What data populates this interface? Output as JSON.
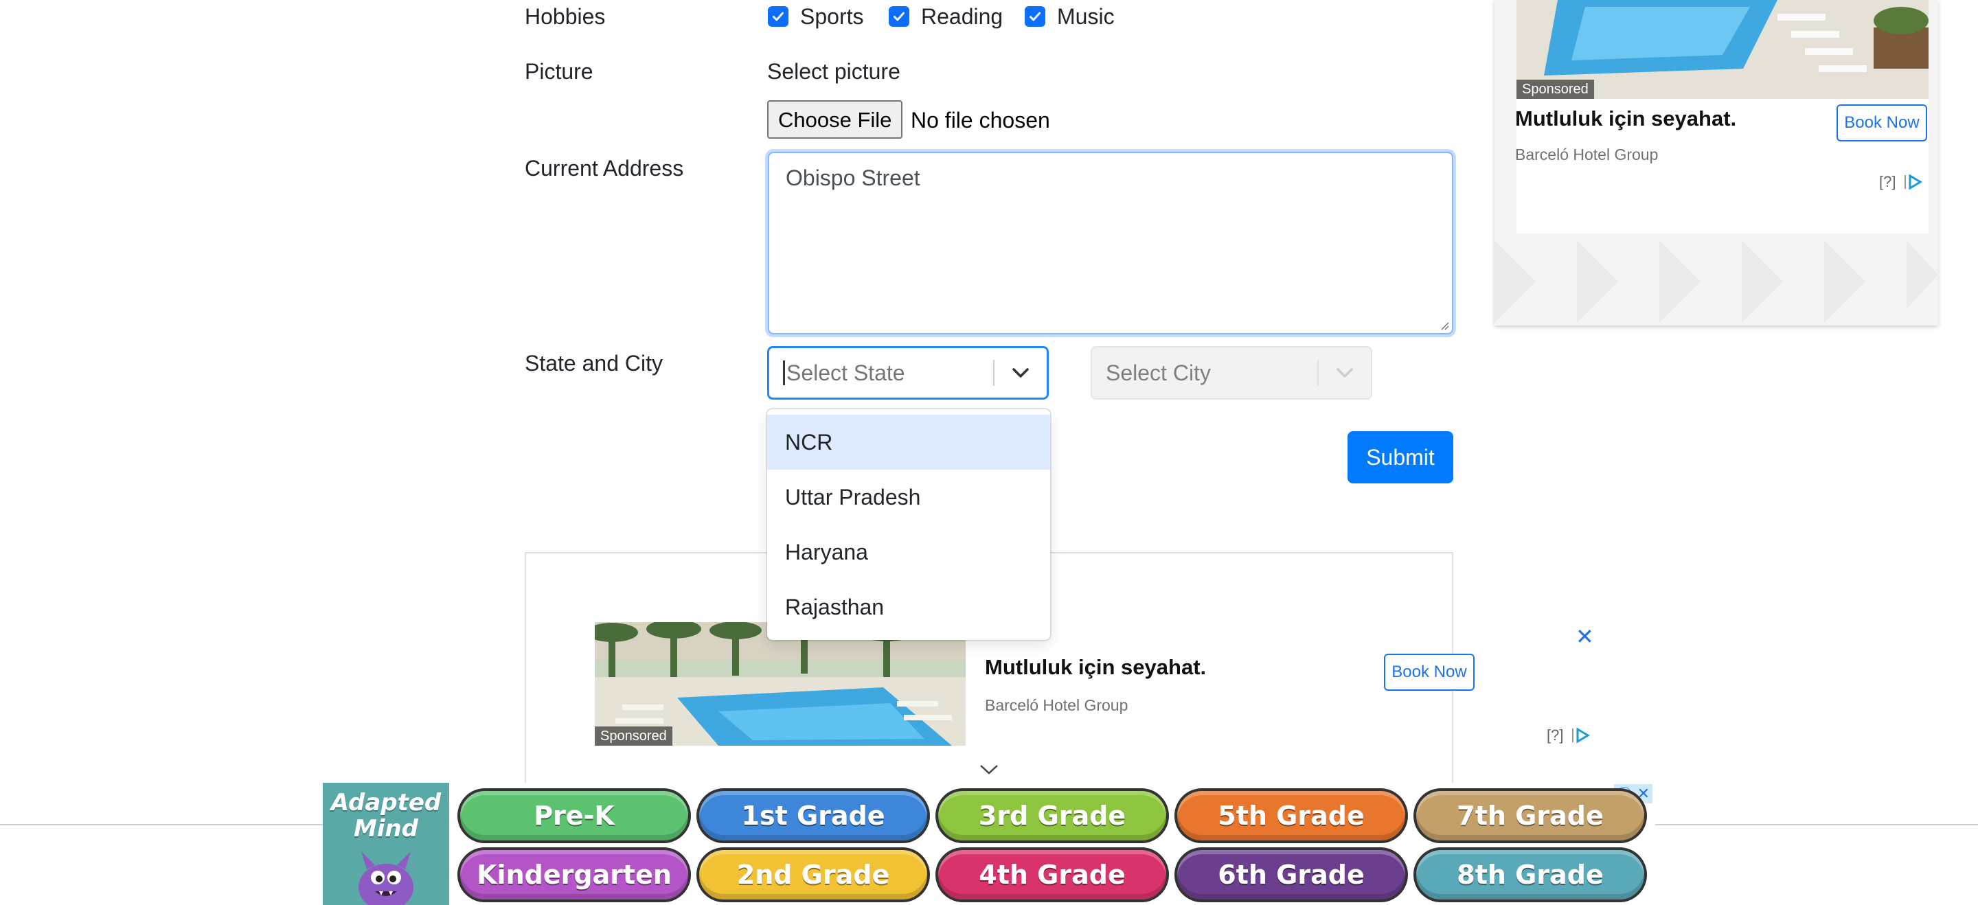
{
  "form": {
    "hobbies_label": "Hobbies",
    "hobbies": [
      {
        "label": "Sports",
        "checked": true
      },
      {
        "label": "Reading",
        "checked": true
      },
      {
        "label": "Music",
        "checked": true
      }
    ],
    "picture_label": "Picture",
    "picture_hint": "Select picture",
    "file_button": "Choose File",
    "file_status": "No file chosen",
    "address_label": "Current Address",
    "address_value": "Obispo Street",
    "state_city_label": "State and City",
    "state_placeholder": "Select State",
    "city_placeholder": "Select City",
    "state_options": [
      "NCR",
      "Uttar Pradesh",
      "Haryana",
      "Rajasthan"
    ],
    "submit_label": "Submit"
  },
  "ads": {
    "side": {
      "sponsored": "Sponsored",
      "title": "Mutluluk için seyahat.",
      "advertiser": "Barceló Hotel Group",
      "cta": "Book Now",
      "adchoice": "[?]"
    },
    "inline": {
      "sponsored": "Sponsored",
      "title": "Mutluluk için seyahat.",
      "advertiser": "Barceló Hotel Group",
      "cta": "Book Now",
      "adchoice": "[?]"
    },
    "banner": {
      "logo_line1": "Adapted",
      "logo_line2": "Mind",
      "grades": [
        {
          "label": "Pre-K",
          "color": "#5cc26f"
        },
        {
          "label": "1st Grade",
          "color": "#3d86d9"
        },
        {
          "label": "3rd Grade",
          "color": "#8dc53e"
        },
        {
          "label": "5th Grade",
          "color": "#e8762c"
        },
        {
          "label": "7th Grade",
          "color": "#c3a06a"
        },
        {
          "label": "Kindergarten",
          "color": "#b455c7"
        },
        {
          "label": "2nd Grade",
          "color": "#f2c235"
        },
        {
          "label": "4th Grade",
          "color": "#d9336d"
        },
        {
          "label": "6th Grade",
          "color": "#6b3f8e"
        },
        {
          "label": "8th Grade",
          "color": "#5aa9b8"
        }
      ]
    }
  },
  "colors": {
    "primary": "#0d6efd",
    "submit": "#007bff",
    "option_focus": "#deebff"
  }
}
